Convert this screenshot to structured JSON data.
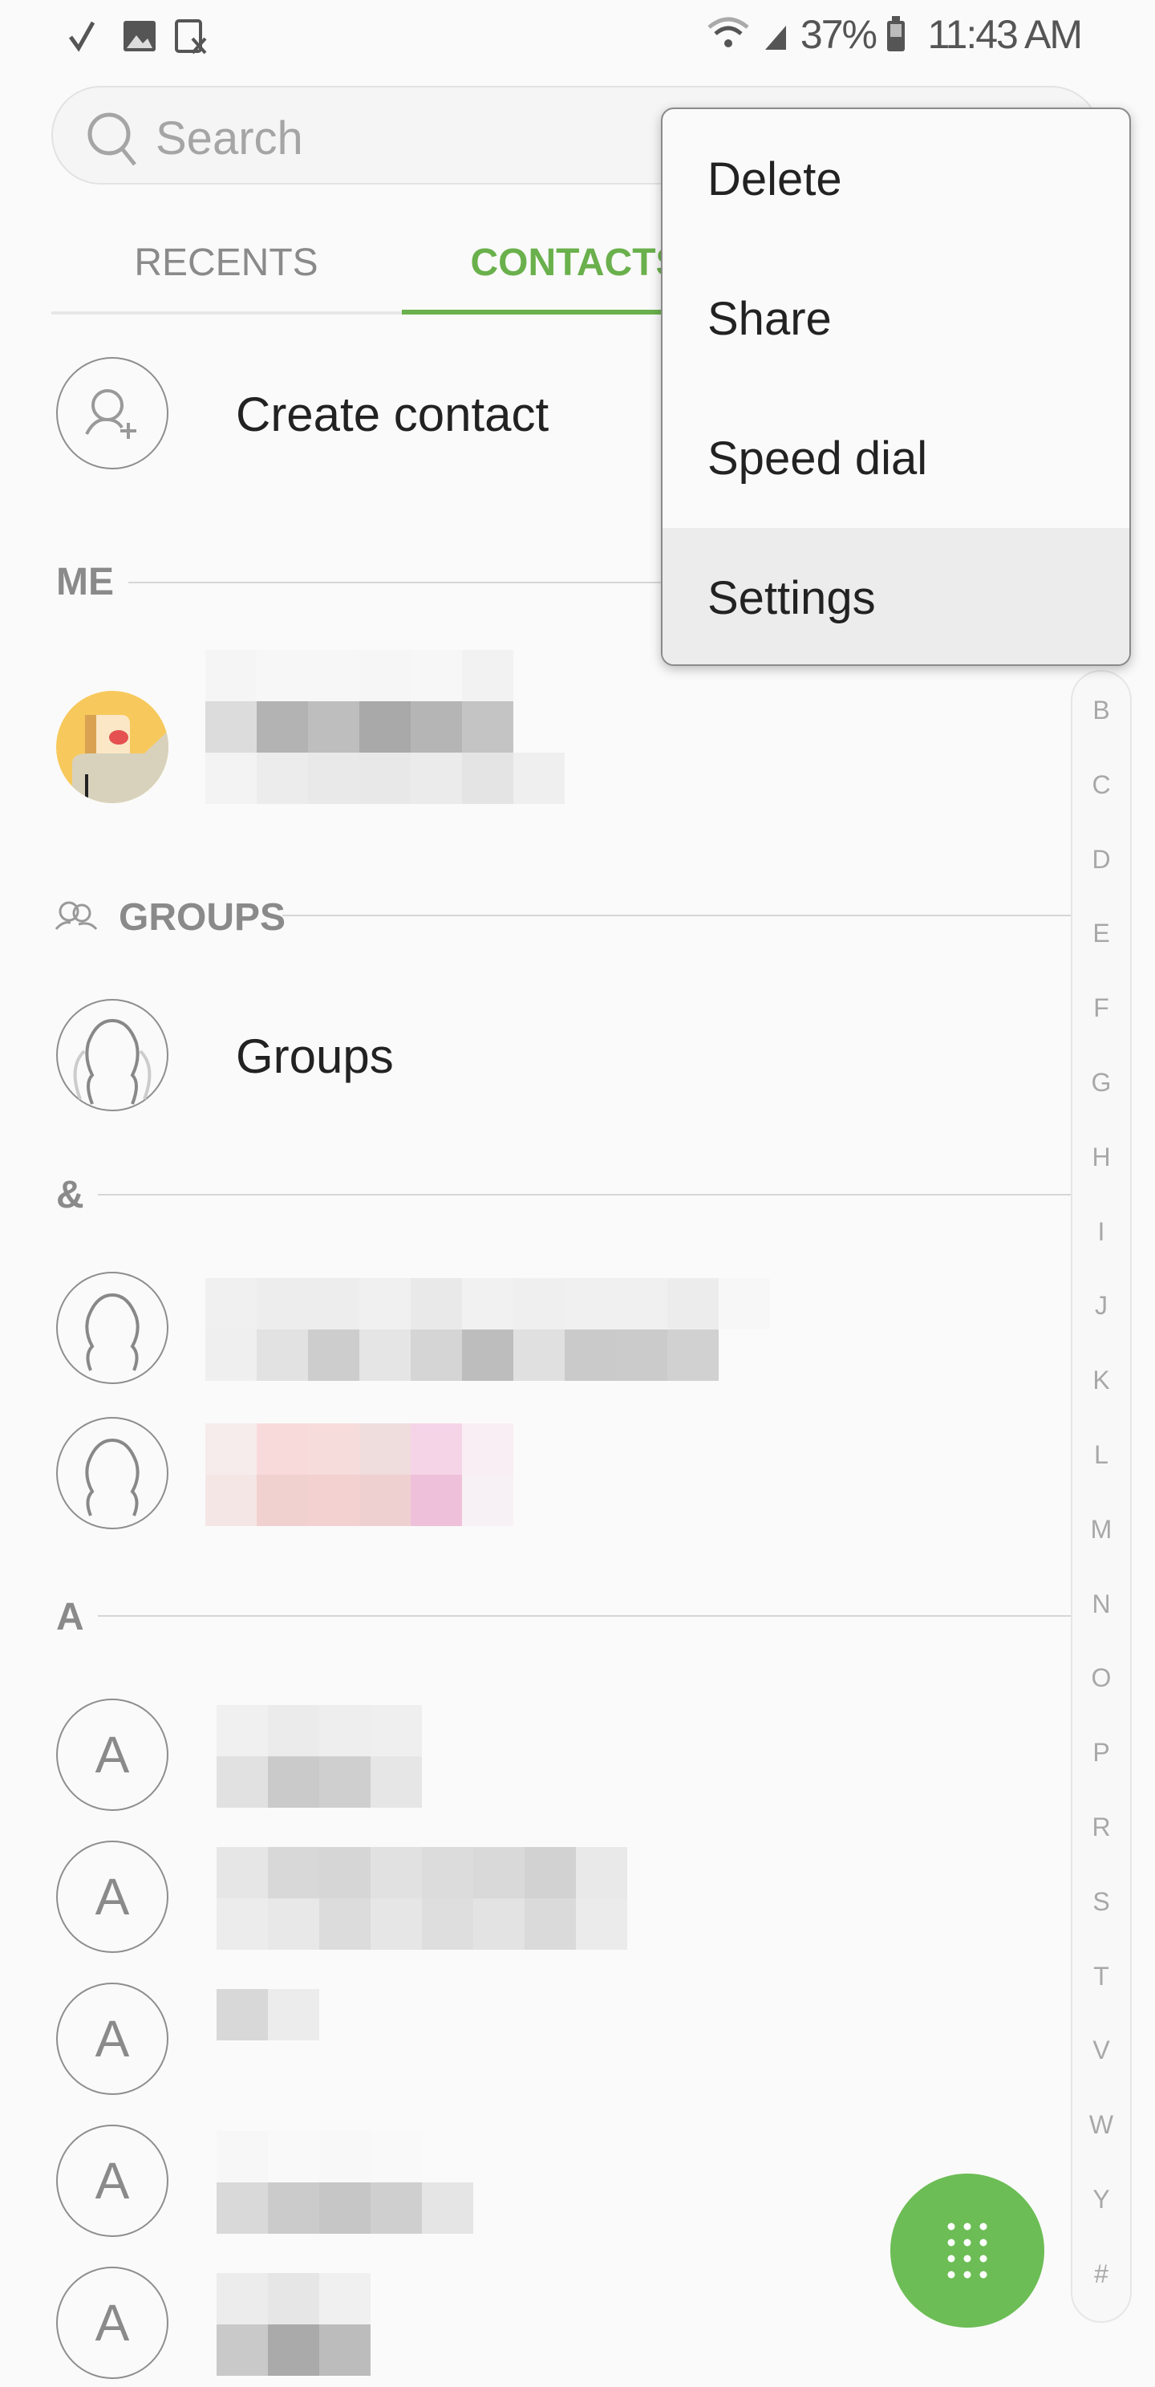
{
  "status_bar": {
    "battery": "37%",
    "time": "11:43 AM",
    "left_icons": [
      "check-icon",
      "image-icon",
      "sim-off-icon"
    ],
    "right_icons": [
      "wifi-icon",
      "signal-icon",
      "battery-icon"
    ]
  },
  "search": {
    "placeholder": "Search"
  },
  "tabs": [
    {
      "label": "RECENTS",
      "active": false
    },
    {
      "label": "CONTACTS",
      "active": true
    }
  ],
  "accent_color": "#6ab04c",
  "create_contact": {
    "label": "Create contact"
  },
  "sections": {
    "me": "ME",
    "groups": "GROUPS",
    "amp": "&",
    "a": "A"
  },
  "groups_item": {
    "label": "Groups"
  },
  "a_contacts_initial": "A",
  "overflow_menu": {
    "items": [
      {
        "label": "Delete"
      },
      {
        "label": "Share"
      },
      {
        "label": "Speed dial"
      },
      {
        "label": "Settings",
        "highlighted": true
      }
    ]
  },
  "index_letters": [
    "B",
    "C",
    "D",
    "E",
    "F",
    "G",
    "H",
    "I",
    "J",
    "K",
    "L",
    "M",
    "N",
    "O",
    "P",
    "R",
    "S",
    "T",
    "V",
    "W",
    "Y",
    "#"
  ],
  "fab": {
    "icon": "dialpad-icon",
    "color": "#6cbd55"
  }
}
